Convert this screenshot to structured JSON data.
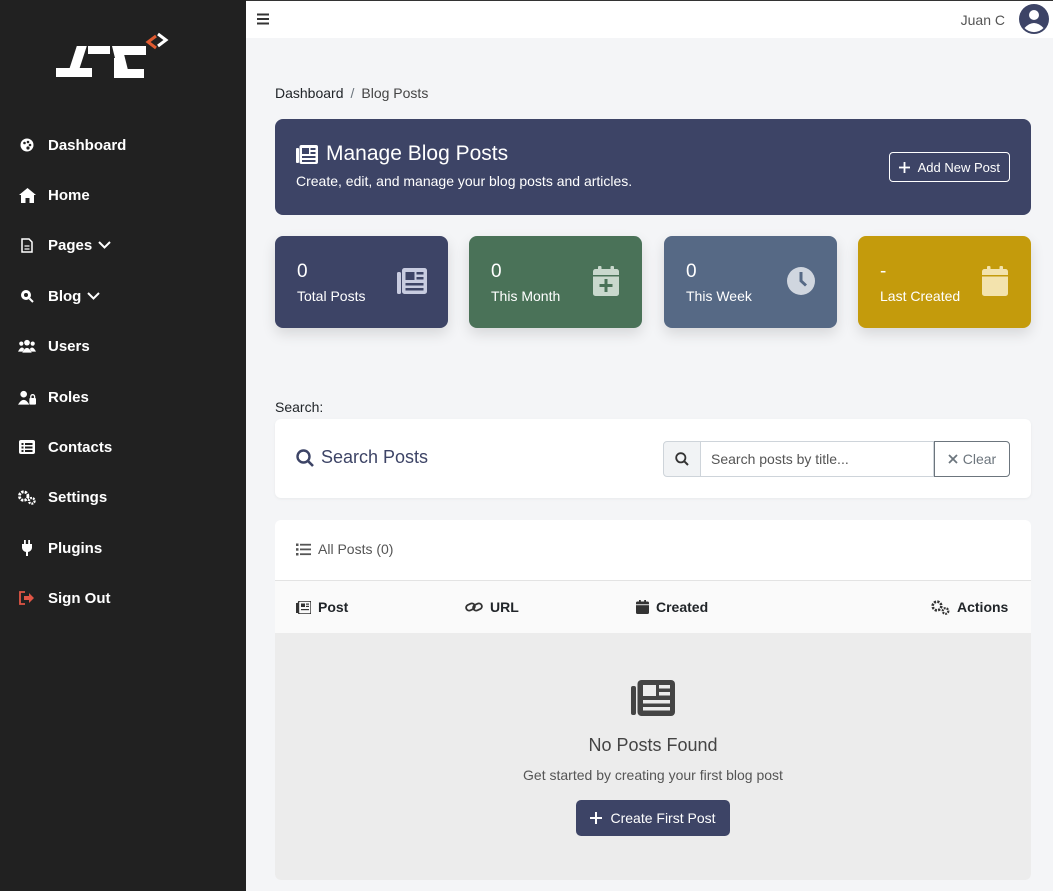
{
  "app": {
    "user_name": "Juan C"
  },
  "sidebar": {
    "items": [
      {
        "label": "Dashboard",
        "icon": "palette-icon"
      },
      {
        "label": "Home",
        "icon": "home-icon"
      },
      {
        "label": "Pages",
        "icon": "file-icon",
        "has_submenu": true
      },
      {
        "label": "Blog",
        "icon": "blog-icon",
        "has_submenu": true
      },
      {
        "label": "Users",
        "icon": "users-icon"
      },
      {
        "label": "Roles",
        "icon": "user-lock-icon"
      },
      {
        "label": "Contacts",
        "icon": "list-icon"
      },
      {
        "label": "Settings",
        "icon": "gears-icon"
      },
      {
        "label": "Plugins",
        "icon": "plug-icon"
      },
      {
        "label": "Sign Out",
        "icon": "sign-out-icon"
      }
    ]
  },
  "breadcrumb": {
    "parent": "Dashboard",
    "separator": "/",
    "current": "Blog Posts"
  },
  "header": {
    "title": "Manage Blog Posts",
    "subtitle": "Create, edit, and manage your blog posts and articles.",
    "add_button": "Add New Post"
  },
  "stats": [
    {
      "value": "0",
      "label": "Total Posts",
      "icon": "newspaper-icon",
      "color": "#3d4466"
    },
    {
      "value": "0",
      "label": "This Month",
      "icon": "calendar-plus-icon",
      "color": "#4a7258"
    },
    {
      "value": "0",
      "label": "This Week",
      "icon": "clock-icon",
      "color": "#566985"
    },
    {
      "value": "-",
      "label": "Last Created",
      "icon": "calendar-icon",
      "color": "#c49b0c"
    }
  ],
  "search": {
    "label": "Search:",
    "title": "Search Posts",
    "placeholder": "Search posts by title...",
    "value": "",
    "clear_label": "Clear"
  },
  "posts": {
    "title": "All Posts (0)",
    "columns": [
      "Post",
      "URL",
      "Created",
      "Actions"
    ],
    "empty_title": "No Posts Found",
    "empty_subtitle": "Get started by creating your first blog post",
    "create_button": "Create First Post"
  },
  "colors": {
    "sidebar": "#212121",
    "primary": "#3d4466",
    "signout": "#e05545",
    "logo_accent": "#e05a30"
  }
}
